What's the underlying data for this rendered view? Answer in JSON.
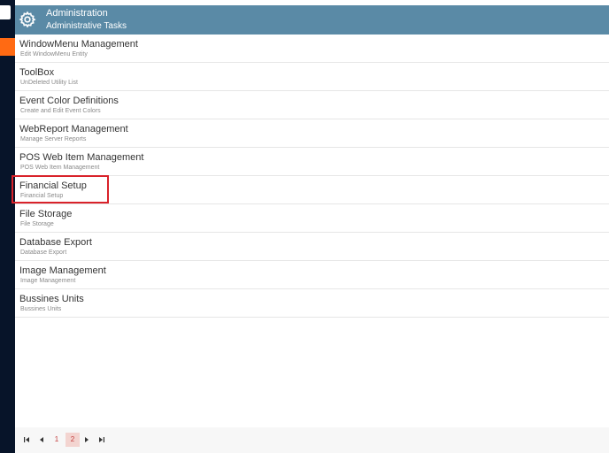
{
  "header": {
    "title": "Administration",
    "subtitle": "Administrative Tasks",
    "icon": "gear-icon"
  },
  "items": [
    {
      "title": "WindowMenu Management",
      "subtitle": "Edit WindowMenu Entity"
    },
    {
      "title": "ToolBox",
      "subtitle": "UnDeleted Utility List"
    },
    {
      "title": "Event Color Definitions",
      "subtitle": "Create and Edit Event Colors"
    },
    {
      "title": "WebReport Management",
      "subtitle": "Manage Server Reports"
    },
    {
      "title": "POS Web Item Management",
      "subtitle": "POS Web Item Management"
    },
    {
      "title": "Financial Setup",
      "subtitle": "Financial Setup"
    },
    {
      "title": "File Storage",
      "subtitle": "File Storage"
    },
    {
      "title": "Database Export",
      "subtitle": "Database Export"
    },
    {
      "title": "Image Management",
      "subtitle": "Image Management"
    },
    {
      "title": "Bussines Units",
      "subtitle": "Bussines Units"
    }
  ],
  "pagination": {
    "pages": [
      "1",
      "2"
    ],
    "current": "2"
  },
  "colors": {
    "header_bg": "#5a8aa6",
    "sidebar_bg": "#071429",
    "accent": "#ff6a13",
    "highlight_border": "#d9222a"
  }
}
